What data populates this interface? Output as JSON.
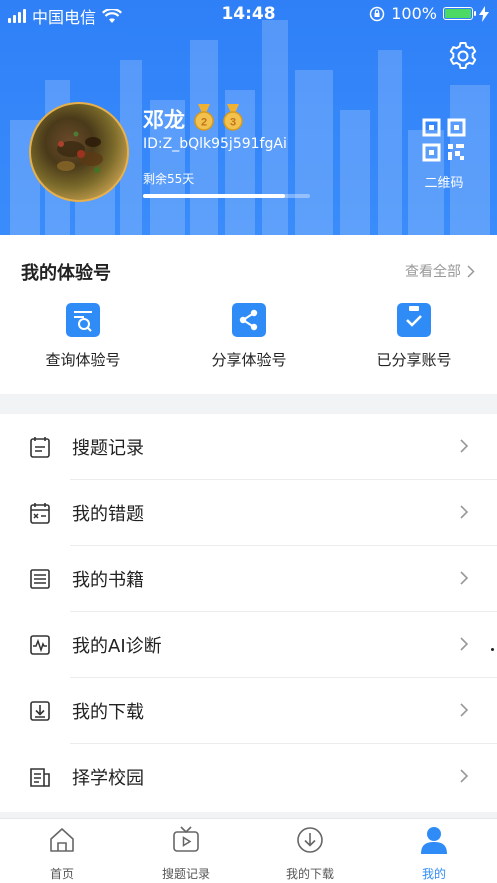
{
  "status_bar": {
    "carrier": "中国电信",
    "time": "14:48",
    "battery": "100%"
  },
  "profile": {
    "name": "邓龙",
    "id": "ID:Z_bQlk95j591fgAi",
    "remaining": "剩余55天",
    "progress": 0.85,
    "qr_label": "二维码",
    "medals": [
      "2",
      "3"
    ]
  },
  "trial": {
    "title": "我的体验号",
    "more": "查看全部",
    "items": [
      {
        "label": "查询体验号",
        "icon": "search-doc-icon"
      },
      {
        "label": "分享体验号",
        "icon": "share-icon"
      },
      {
        "label": "已分享账号",
        "icon": "clipboard-check-icon"
      }
    ]
  },
  "menu": {
    "items": [
      {
        "label": "搜题记录",
        "icon": "notepad-icon"
      },
      {
        "label": "我的错题",
        "icon": "calendar-x-icon"
      },
      {
        "label": "我的书籍",
        "icon": "book-lines-icon"
      },
      {
        "label": "我的AI诊断",
        "icon": "pulse-icon"
      },
      {
        "label": "我的下载",
        "icon": "download-icon"
      },
      {
        "label": "择学校园",
        "icon": "school-doc-icon"
      }
    ]
  },
  "tabs": [
    {
      "label": "首页",
      "icon": "home-icon"
    },
    {
      "label": "搜题记录",
      "icon": "tv-play-icon"
    },
    {
      "label": "我的下载",
      "icon": "download-circle-icon"
    },
    {
      "label": "我的",
      "icon": "person-icon",
      "active": true
    }
  ],
  "colors": {
    "primary": "#2f8cf7",
    "header": "#3a8cfb",
    "medal": "#e8b04a",
    "battery": "#4cd964"
  }
}
